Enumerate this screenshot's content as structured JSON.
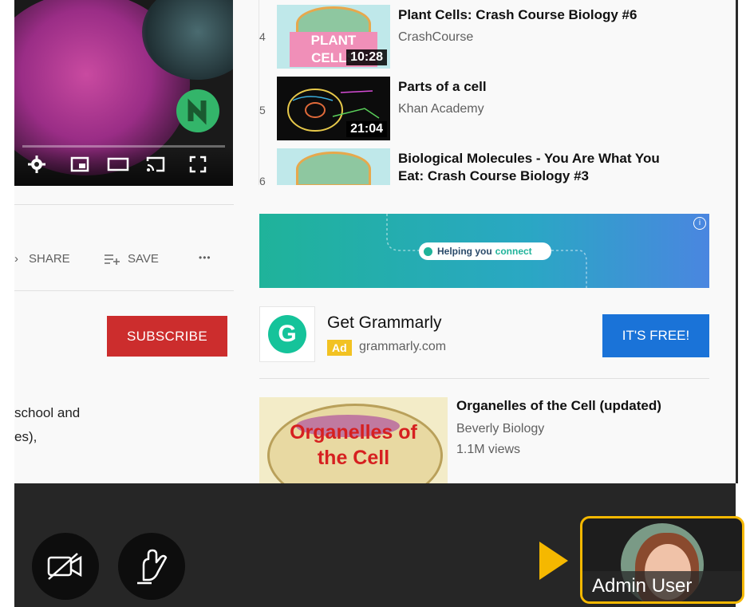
{
  "player": {
    "controls": [
      "settings-icon",
      "miniplayer-icon",
      "theater-icon",
      "cast-icon",
      "fullscreen-icon"
    ]
  },
  "actions": {
    "share_label": "SHARE",
    "save_label": "SAVE",
    "more_label": "•••"
  },
  "channel": {
    "subscribe_label": "SUBSCRIBE"
  },
  "description": {
    "line1": "school and",
    "line2": "es),"
  },
  "playlist": [
    {
      "index": "4",
      "title": "Plant Cells: Crash Course Biology #6",
      "channel": "CrashCourse",
      "duration": "10:28",
      "thumb_text": "PLANT CELLS"
    },
    {
      "index": "5",
      "title": "Parts of a cell",
      "channel": "Khan Academy",
      "duration": "21:04"
    },
    {
      "index": "6",
      "title": "Biological Molecules - You Are What You Eat: Crash Course Biology #3"
    }
  ],
  "ad_banner": {
    "pill_text_1": "Helping you",
    "pill_text_2": "connect",
    "info": "i"
  },
  "ad": {
    "title": "Get Grammarly",
    "badge": "Ad",
    "domain": "grammarly.com",
    "cta": "IT'S FREE!",
    "logo_letter": "G"
  },
  "related": {
    "title": "Organelles of the Cell (updated)",
    "channel": "Beverly Biology",
    "views": "1.1M views",
    "thumb_line1": "Organelles of",
    "thumb_line2": "the Cell"
  },
  "conference": {
    "user_name": "Admin User",
    "camera_button": "camera-off-icon",
    "gesture_button": "raise-hand-icon"
  },
  "colors": {
    "subscribe_red": "#cc2d2d",
    "cta_blue": "#1a73d8",
    "highlight_yellow": "#f5b800",
    "bar_dark": "#262626"
  }
}
